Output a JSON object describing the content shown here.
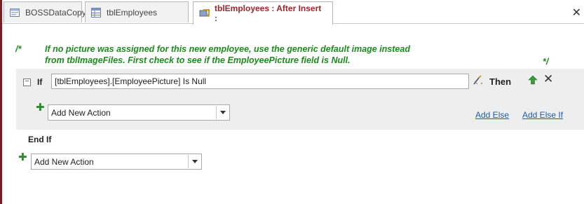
{
  "tabs": [
    {
      "label": "BOSSDataCopy",
      "icon": "form-icon",
      "active": false
    },
    {
      "label": "tblEmployees",
      "icon": "table-icon",
      "active": false
    },
    {
      "label": "tblEmployees : After Insert :",
      "icon": "macro-icon",
      "active": true
    }
  ],
  "comment": {
    "open": "/*",
    "line1": "If no picture was assigned for this new employee, use the generic default image instead",
    "line2": "from tblImageFiles. First check to see if the EmployeePicture field is Null.",
    "close": "*/"
  },
  "if_block": {
    "if_label": "If",
    "condition": "[tblEmployees].[EmployeePicture] Is Null",
    "then_label": "Then",
    "action_select": "Add New Action",
    "add_else": "Add Else",
    "add_else_if": "Add Else If"
  },
  "end_if": "End If",
  "bottom_action_select": "Add New Action",
  "colors": {
    "comment": "#1d8a1d",
    "active_tab": "#a0252a",
    "link": "#1a5ea8",
    "block_bg": "#eeeeee"
  }
}
